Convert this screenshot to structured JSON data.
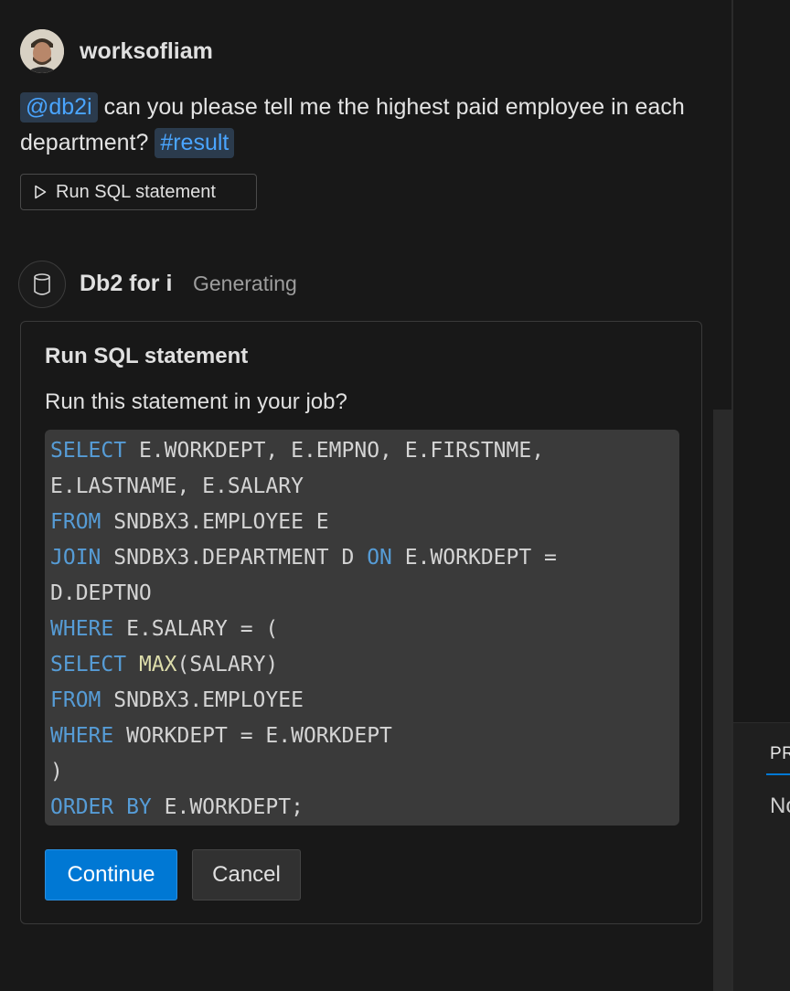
{
  "user_message": {
    "username": "worksofliam",
    "mention_chip": "@db2i",
    "text": " can you please tell me the highest paid employee in each department? ",
    "reference_chip": "#result",
    "run_button_label": "Run SQL statement"
  },
  "assistant": {
    "name": "Db2 for i",
    "status": "Generating"
  },
  "confirmation": {
    "title": "Run SQL statement",
    "question": "Run this statement in your job?",
    "continue_label": "Continue",
    "cancel_label": "Cancel",
    "code_lines": [
      [
        {
          "k": "kw",
          "t": "SELECT"
        },
        {
          "k": "",
          "t": " E.WORKDEPT, E.EMPNO, E.FIRSTNME,"
        }
      ],
      [
        {
          "k": "",
          "t": "E.LASTNAME, E.SALARY"
        }
      ],
      [
        {
          "k": "kw",
          "t": "FROM"
        },
        {
          "k": "",
          "t": " SNDBX3.EMPLOYEE E"
        }
      ],
      [
        {
          "k": "kw",
          "t": "JOIN"
        },
        {
          "k": "",
          "t": " SNDBX3.DEPARTMENT D "
        },
        {
          "k": "kw",
          "t": "ON"
        },
        {
          "k": "",
          "t": " E.WORKDEPT ="
        }
      ],
      [
        {
          "k": "",
          "t": "D.DEPTNO"
        }
      ],
      [
        {
          "k": "kw",
          "t": "WHERE"
        },
        {
          "k": "",
          "t": " E.SALARY = ("
        }
      ],
      [
        {
          "k": "kw",
          "t": "SELECT"
        },
        {
          "k": "",
          "t": " "
        },
        {
          "k": "fn",
          "t": "MAX"
        },
        {
          "k": "",
          "t": "(SALARY)"
        }
      ],
      [
        {
          "k": "kw",
          "t": "FROM"
        },
        {
          "k": "",
          "t": " SNDBX3.EMPLOYEE"
        }
      ],
      [
        {
          "k": "kw",
          "t": "WHERE"
        },
        {
          "k": "",
          "t": " WORKDEPT = E.WORKDEPT"
        }
      ],
      [
        {
          "k": "",
          "t": ")"
        }
      ],
      [
        {
          "k": "kw",
          "t": "ORDER BY"
        },
        {
          "k": "",
          "t": " E.WORKDEPT;"
        }
      ]
    ]
  },
  "side_panel": {
    "tab_label": "PR",
    "body_text": "No"
  },
  "colors": {
    "background": "#181818",
    "accent": "#0078d4",
    "chip_text": "#4aa5ff",
    "sql_keyword": "#569cd6",
    "sql_function": "#dcdcaa"
  }
}
